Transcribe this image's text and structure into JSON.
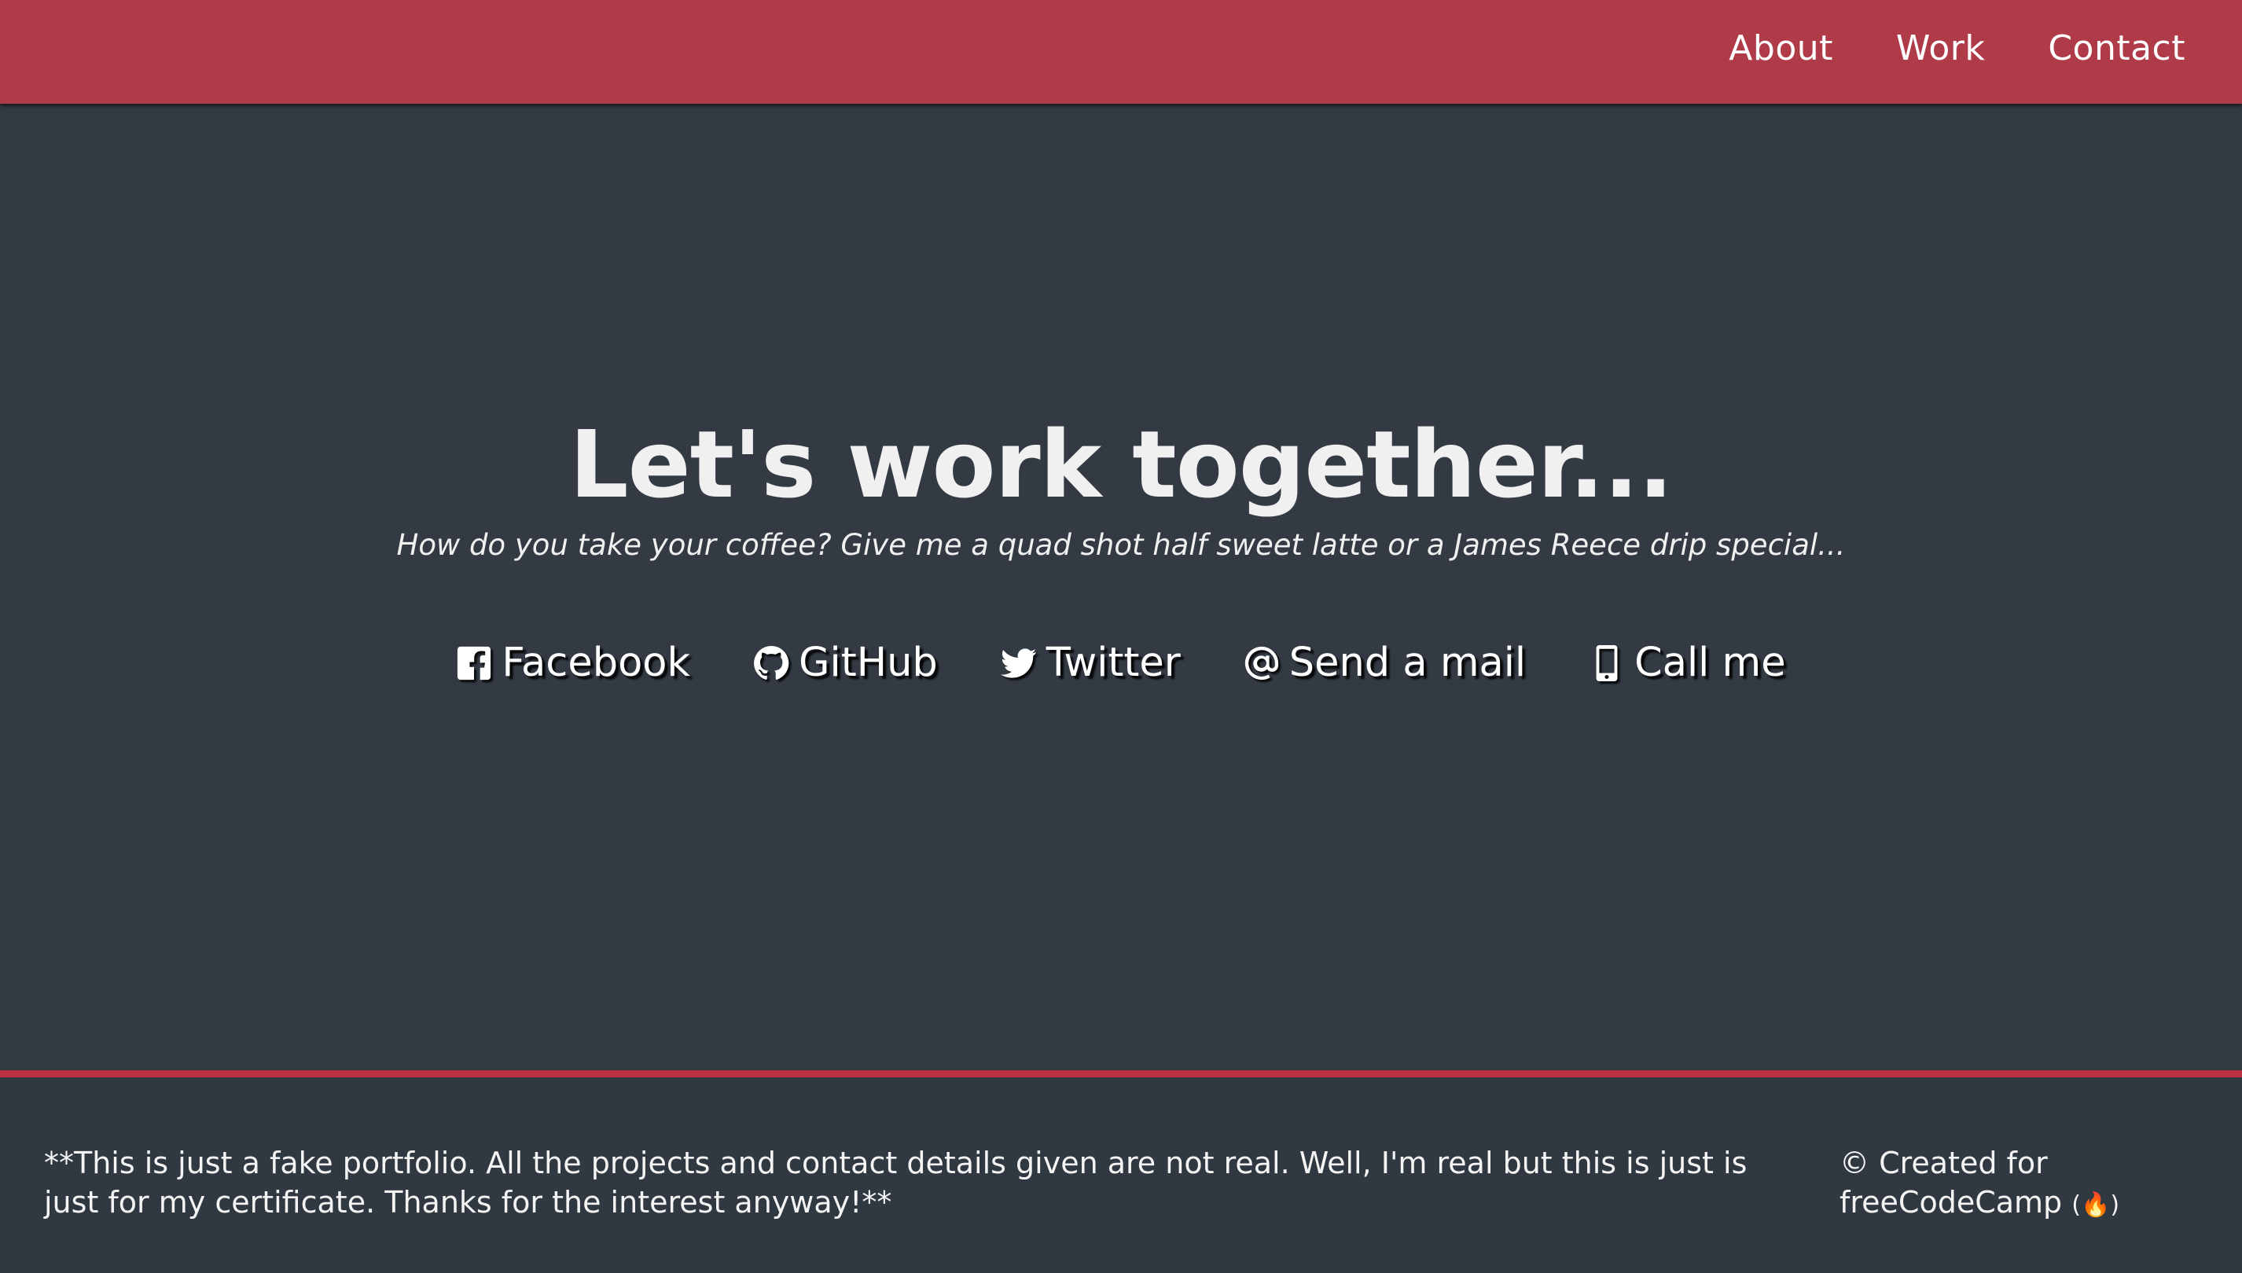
{
  "navbar": {
    "items": [
      {
        "label": "About"
      },
      {
        "label": "Work"
      },
      {
        "label": "Contact"
      }
    ],
    "background": "#b03b48"
  },
  "contact": {
    "title": "Let's work together...",
    "subtitle": "How do you take your coffee? Give me a quad shot half sweet latte or a James Reece drip special...",
    "links": [
      {
        "label": "Facebook",
        "icon": "facebook-square-icon"
      },
      {
        "label": "GitHub",
        "icon": "github-icon"
      },
      {
        "label": "Twitter",
        "icon": "twitter-icon"
      },
      {
        "label": "Send a mail",
        "icon": "at-icon"
      },
      {
        "label": "Call me",
        "icon": "mobile-phone-icon"
      }
    ],
    "background": "#333a43"
  },
  "footer": {
    "note": "**This is just a fake portfolio. All the projects and contact details given are not real. Well, I'm real but this is just is just for my certificate. Thanks for the interest anyway!**",
    "credit_prefix": "© Created for freeCodeCamp",
    "credit_link_glyph": "(🔥)",
    "accent": "#be3144"
  }
}
